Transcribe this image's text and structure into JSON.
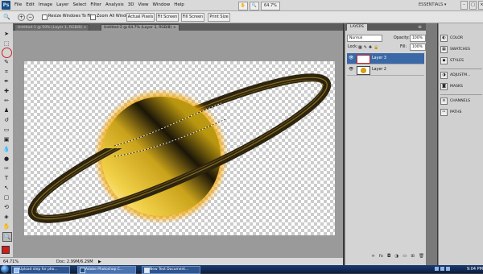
{
  "app": {
    "logo": "Ps"
  },
  "menu": [
    "File",
    "Edit",
    "Image",
    "Layer",
    "Select",
    "Filter",
    "Analysis",
    "3D",
    "View",
    "Window",
    "Help"
  ],
  "menubar_buttons": {
    "hand": "✋",
    "zoom": "🔍",
    "percent": "64.7%"
  },
  "workspace": {
    "label": "ESSENTIALS ▾"
  },
  "window_controls": [
    "–",
    "□",
    "×"
  ],
  "options": {
    "resize_label": "Resize Windows To Fit",
    "zoom_all_label": "Zoom All Windows",
    "actual_pixels": "Actual Pixels",
    "fit_screen": "Fit Screen",
    "fill_screen": "Fill Screen",
    "print_size": "Print Size"
  },
  "tabs": [
    {
      "label": "Untitled-1 @ 50% (Layer 1, RGB/8) ×",
      "active": false
    },
    {
      "label": "Untitled-2 @ 64.7% (Layer 3, RGB/8) ×",
      "active": true
    }
  ],
  "status": {
    "zoom": "64.71%",
    "doc": "Doc: 2.99M/6.29M"
  },
  "layers_panel": {
    "tab": "LAYERS",
    "blend_mode": "Normal",
    "opacity_label": "Opacity:",
    "opacity_value": "100%",
    "lock_label": "Lock:",
    "fill_label": "Fill:",
    "fill_value": "100%",
    "layers": [
      {
        "name": "Layer 3",
        "active": true
      },
      {
        "name": "Layer 2",
        "active": false
      }
    ],
    "bottom_icons": [
      "∞",
      "fx",
      "◘",
      "◑",
      "▭",
      "⊞",
      "🗑"
    ]
  },
  "dock": {
    "items": [
      {
        "label": "COLOR",
        "icon": "color-icon"
      },
      {
        "label": "SWATCHES",
        "icon": "swatches-icon"
      },
      {
        "label": "STYLES",
        "icon": "styles-icon"
      },
      {
        "label": "ADJUSTM...",
        "icon": "adjustments-icon"
      },
      {
        "label": "MASKS",
        "icon": "masks-icon"
      },
      {
        "label": "CHANNELS",
        "icon": "channels-icon"
      },
      {
        "label": "PATHS",
        "icon": "paths-icon"
      }
    ]
  },
  "taskbar": {
    "tasks": [
      "Upload step for pho...",
      "Adobe Photoshop C...",
      "New Text Document..."
    ],
    "clock": "9:04 PM"
  },
  "colors": {
    "accent": "#3b68a6",
    "foreground": "#d01c1c",
    "background": "#000000"
  }
}
